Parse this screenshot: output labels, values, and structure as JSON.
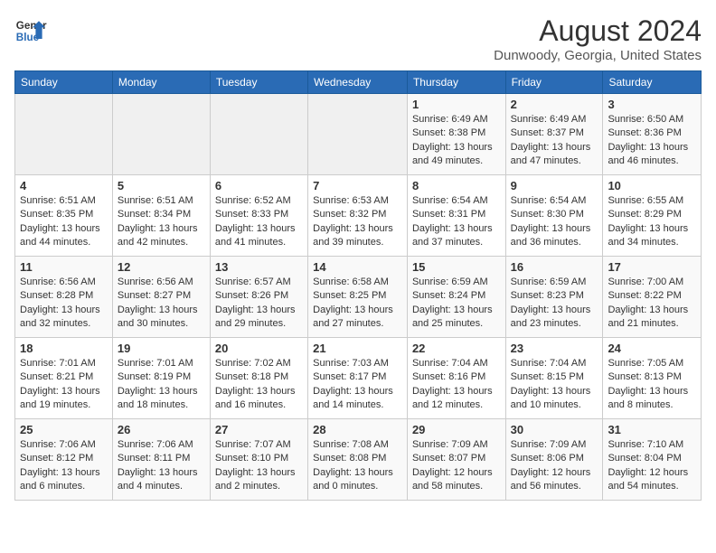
{
  "header": {
    "logo_line1": "General",
    "logo_line2": "Blue",
    "main_title": "August 2024",
    "subtitle": "Dunwoody, Georgia, United States"
  },
  "weekdays": [
    "Sunday",
    "Monday",
    "Tuesday",
    "Wednesday",
    "Thursday",
    "Friday",
    "Saturday"
  ],
  "weeks": [
    [
      {
        "day": "",
        "info": ""
      },
      {
        "day": "",
        "info": ""
      },
      {
        "day": "",
        "info": ""
      },
      {
        "day": "",
        "info": ""
      },
      {
        "day": "1",
        "info": "Sunrise: 6:49 AM\nSunset: 8:38 PM\nDaylight: 13 hours\nand 49 minutes."
      },
      {
        "day": "2",
        "info": "Sunrise: 6:49 AM\nSunset: 8:37 PM\nDaylight: 13 hours\nand 47 minutes."
      },
      {
        "day": "3",
        "info": "Sunrise: 6:50 AM\nSunset: 8:36 PM\nDaylight: 13 hours\nand 46 minutes."
      }
    ],
    [
      {
        "day": "4",
        "info": "Sunrise: 6:51 AM\nSunset: 8:35 PM\nDaylight: 13 hours\nand 44 minutes."
      },
      {
        "day": "5",
        "info": "Sunrise: 6:51 AM\nSunset: 8:34 PM\nDaylight: 13 hours\nand 42 minutes."
      },
      {
        "day": "6",
        "info": "Sunrise: 6:52 AM\nSunset: 8:33 PM\nDaylight: 13 hours\nand 41 minutes."
      },
      {
        "day": "7",
        "info": "Sunrise: 6:53 AM\nSunset: 8:32 PM\nDaylight: 13 hours\nand 39 minutes."
      },
      {
        "day": "8",
        "info": "Sunrise: 6:54 AM\nSunset: 8:31 PM\nDaylight: 13 hours\nand 37 minutes."
      },
      {
        "day": "9",
        "info": "Sunrise: 6:54 AM\nSunset: 8:30 PM\nDaylight: 13 hours\nand 36 minutes."
      },
      {
        "day": "10",
        "info": "Sunrise: 6:55 AM\nSunset: 8:29 PM\nDaylight: 13 hours\nand 34 minutes."
      }
    ],
    [
      {
        "day": "11",
        "info": "Sunrise: 6:56 AM\nSunset: 8:28 PM\nDaylight: 13 hours\nand 32 minutes."
      },
      {
        "day": "12",
        "info": "Sunrise: 6:56 AM\nSunset: 8:27 PM\nDaylight: 13 hours\nand 30 minutes."
      },
      {
        "day": "13",
        "info": "Sunrise: 6:57 AM\nSunset: 8:26 PM\nDaylight: 13 hours\nand 29 minutes."
      },
      {
        "day": "14",
        "info": "Sunrise: 6:58 AM\nSunset: 8:25 PM\nDaylight: 13 hours\nand 27 minutes."
      },
      {
        "day": "15",
        "info": "Sunrise: 6:59 AM\nSunset: 8:24 PM\nDaylight: 13 hours\nand 25 minutes."
      },
      {
        "day": "16",
        "info": "Sunrise: 6:59 AM\nSunset: 8:23 PM\nDaylight: 13 hours\nand 23 minutes."
      },
      {
        "day": "17",
        "info": "Sunrise: 7:00 AM\nSunset: 8:22 PM\nDaylight: 13 hours\nand 21 minutes."
      }
    ],
    [
      {
        "day": "18",
        "info": "Sunrise: 7:01 AM\nSunset: 8:21 PM\nDaylight: 13 hours\nand 19 minutes."
      },
      {
        "day": "19",
        "info": "Sunrise: 7:01 AM\nSunset: 8:19 PM\nDaylight: 13 hours\nand 18 minutes."
      },
      {
        "day": "20",
        "info": "Sunrise: 7:02 AM\nSunset: 8:18 PM\nDaylight: 13 hours\nand 16 minutes."
      },
      {
        "day": "21",
        "info": "Sunrise: 7:03 AM\nSunset: 8:17 PM\nDaylight: 13 hours\nand 14 minutes."
      },
      {
        "day": "22",
        "info": "Sunrise: 7:04 AM\nSunset: 8:16 PM\nDaylight: 13 hours\nand 12 minutes."
      },
      {
        "day": "23",
        "info": "Sunrise: 7:04 AM\nSunset: 8:15 PM\nDaylight: 13 hours\nand 10 minutes."
      },
      {
        "day": "24",
        "info": "Sunrise: 7:05 AM\nSunset: 8:13 PM\nDaylight: 13 hours\nand 8 minutes."
      }
    ],
    [
      {
        "day": "25",
        "info": "Sunrise: 7:06 AM\nSunset: 8:12 PM\nDaylight: 13 hours\nand 6 minutes."
      },
      {
        "day": "26",
        "info": "Sunrise: 7:06 AM\nSunset: 8:11 PM\nDaylight: 13 hours\nand 4 minutes."
      },
      {
        "day": "27",
        "info": "Sunrise: 7:07 AM\nSunset: 8:10 PM\nDaylight: 13 hours\nand 2 minutes."
      },
      {
        "day": "28",
        "info": "Sunrise: 7:08 AM\nSunset: 8:08 PM\nDaylight: 13 hours\nand 0 minutes."
      },
      {
        "day": "29",
        "info": "Sunrise: 7:09 AM\nSunset: 8:07 PM\nDaylight: 12 hours\nand 58 minutes."
      },
      {
        "day": "30",
        "info": "Sunrise: 7:09 AM\nSunset: 8:06 PM\nDaylight: 12 hours\nand 56 minutes."
      },
      {
        "day": "31",
        "info": "Sunrise: 7:10 AM\nSunset: 8:04 PM\nDaylight: 12 hours\nand 54 minutes."
      }
    ]
  ]
}
